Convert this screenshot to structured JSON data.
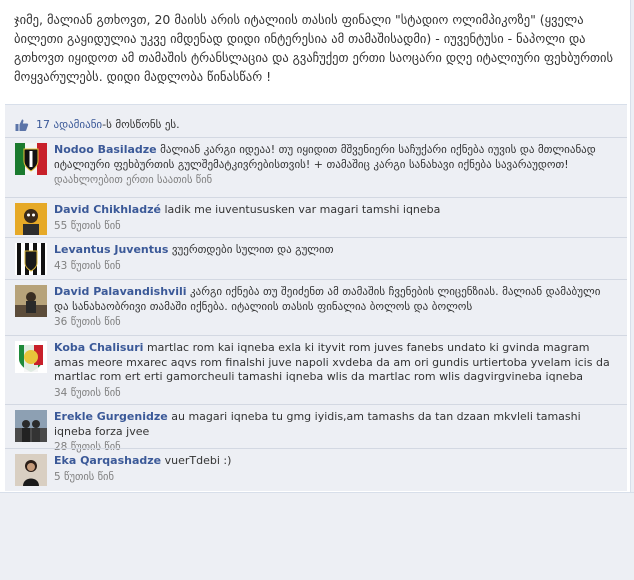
{
  "post": {
    "text": "ჯიმე, მალიან გთხოვთ, 20 მაისს არის იტალიის თასის ფინალი \"სტადიო ოლიმპიკოზე\" (ყველა ბილეთი გაყიდულია უკვე იმდენად დიდი ინტერესია ამ თამაშისადმი) - იუვენტუსი - ნაპოლი და გთხოვთ იყიდოთ ამ თამაშის ტრანსლაცია და გვაჩუქეთ ერთი საოცარი დღე იტალიური ფეხბურთის მოყვარულებს. დიდი მადლობა წინასწარ !"
  },
  "likes": {
    "count": "17 ადამიანი",
    "rest": "-ს მოსწონს ეს."
  },
  "comments": [
    {
      "name": "Nodoo Basiladze",
      "text": "მალიან კარგი იდეაა! თუ იყიდით მშვენიერი საჩუქარი იქნება იუვის და მთლიანად იტალიური ფეხბურთის გულშემატკივრებისთვის! + თამაშიც კარგი სანახავი იქნება სავარაუდოთ!",
      "time": "დაახლოებით ერთი საათის წინ",
      "avatar": "juventus-crest"
    },
    {
      "name": "David Chikhladzé",
      "text": "ladik me iuventususken var magari tamshi iqneba",
      "time": "55 წუთის წინ",
      "avatar": "cartoon"
    },
    {
      "name": "Levantus Juventus",
      "text": "ვუერთდები სულით და გულით",
      "time": "43 წუთის წინ",
      "avatar": "juventus-stripes"
    },
    {
      "name": "David Palavandishvili",
      "text": "კარგი იქნება თუ შეიძენთ ამ თამაშის ჩვენების ლიცენზიას. მალიან დამაბული და სანახაობრივი თამაში იქნება. იტალიის თასის ფინალია ბოლოს და ბოლოს",
      "time": "36 წუთის წინ",
      "avatar": "photo-person"
    },
    {
      "name": "Koba Chalisuri",
      "text": "martlac rom kai iqneba exla ki ityvit rom juves fanebs undato ki gvinda magram amas meore mxarec aqvs rom finalshi juve napoli xvdeba da am ori gundis urtiertoba yvelam icis da martlac rom ert erti gamorcheuli tamashi iqneba wlis da martlac rom wlis dagvirgvineba iqneba",
      "time": "34 წუთის წინ",
      "avatar": "juventus-30"
    },
    {
      "name": "Erekle Gurgenidze",
      "text": "au magari iqneba tu gmg iyidis,am tamashs da tan dzaan mkvleli tamashi iqneba forza jvee",
      "time": "28 წუთის წინ",
      "avatar": "photo-group"
    },
    {
      "name": "Eka Qarqashadze",
      "text": "vuerTdebi :)",
      "time": "5 წუთის წინ",
      "avatar": "photo-woman"
    }
  ],
  "colors": {
    "link": "#3b5998",
    "feedback_bg": "#edeff4",
    "time": "#808080"
  }
}
